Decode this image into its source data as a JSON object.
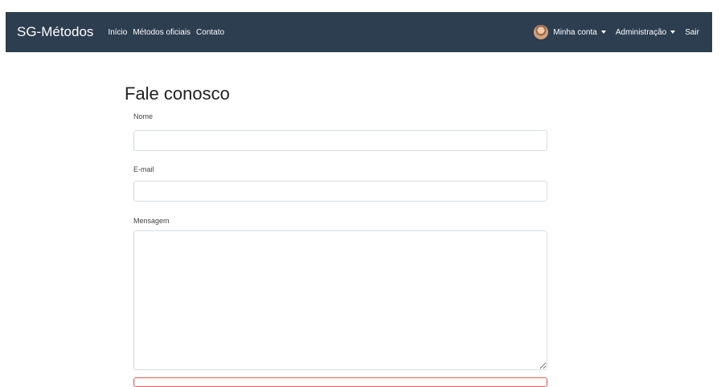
{
  "navbar": {
    "brand": "SG-Métodos",
    "links": [
      "Início",
      "Métodos oficiais",
      "Contato"
    ],
    "account_label": "Minha conta",
    "admin_label": "Administração",
    "logout_label": "Sair"
  },
  "form": {
    "title": "Fale conosco",
    "name_label": "Nome",
    "name_value": "",
    "email_label": "E-mail",
    "email_value": "",
    "message_label": "Mensagem",
    "message_value": ""
  },
  "colors": {
    "navbar_bg": "#2c3e50",
    "navbar_text": "#ffffff",
    "field_border": "#d7dce1",
    "error_border": "#e4605b"
  }
}
